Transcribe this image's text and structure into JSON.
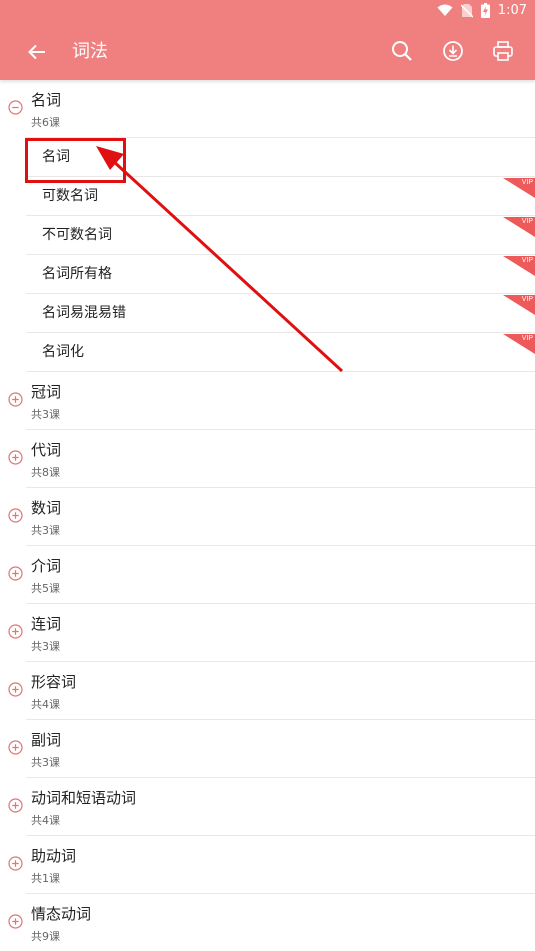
{
  "status": {
    "time": "1:07"
  },
  "appbar": {
    "title": "词法",
    "back_icon": "arrow-left-icon",
    "search_icon": "search-icon",
    "download_icon": "download-icon",
    "print_icon": "printer-icon"
  },
  "colors": {
    "primary": "#f08080",
    "accent_red": "#e01010",
    "vip_badge": "#ee5a5a"
  },
  "groups": [
    {
      "title": "名词",
      "count": "共6课",
      "expanded": true,
      "lessons": [
        {
          "title": "名词",
          "vip": false
        },
        {
          "title": "可数名词",
          "vip": true,
          "badge": "VIP"
        },
        {
          "title": "不可数名词",
          "vip": true,
          "badge": "VIP"
        },
        {
          "title": "名词所有格",
          "vip": true,
          "badge": "VIP"
        },
        {
          "title": "名词易混易错",
          "vip": true,
          "badge": "VIP"
        },
        {
          "title": "名词化",
          "vip": true,
          "badge": "VIP"
        }
      ]
    },
    {
      "title": "冠词",
      "count": "共3课",
      "expanded": false
    },
    {
      "title": "代词",
      "count": "共8课",
      "expanded": false
    },
    {
      "title": "数词",
      "count": "共3课",
      "expanded": false
    },
    {
      "title": "介词",
      "count": "共5课",
      "expanded": false
    },
    {
      "title": "连词",
      "count": "共3课",
      "expanded": false
    },
    {
      "title": "形容词",
      "count": "共4课",
      "expanded": false
    },
    {
      "title": "副词",
      "count": "共3课",
      "expanded": false
    },
    {
      "title": "动词和短语动词",
      "count": "共4课",
      "expanded": false
    },
    {
      "title": "助动词",
      "count": "共1课",
      "expanded": false
    },
    {
      "title": "情态动词",
      "count": "共9课",
      "expanded": false
    }
  ]
}
